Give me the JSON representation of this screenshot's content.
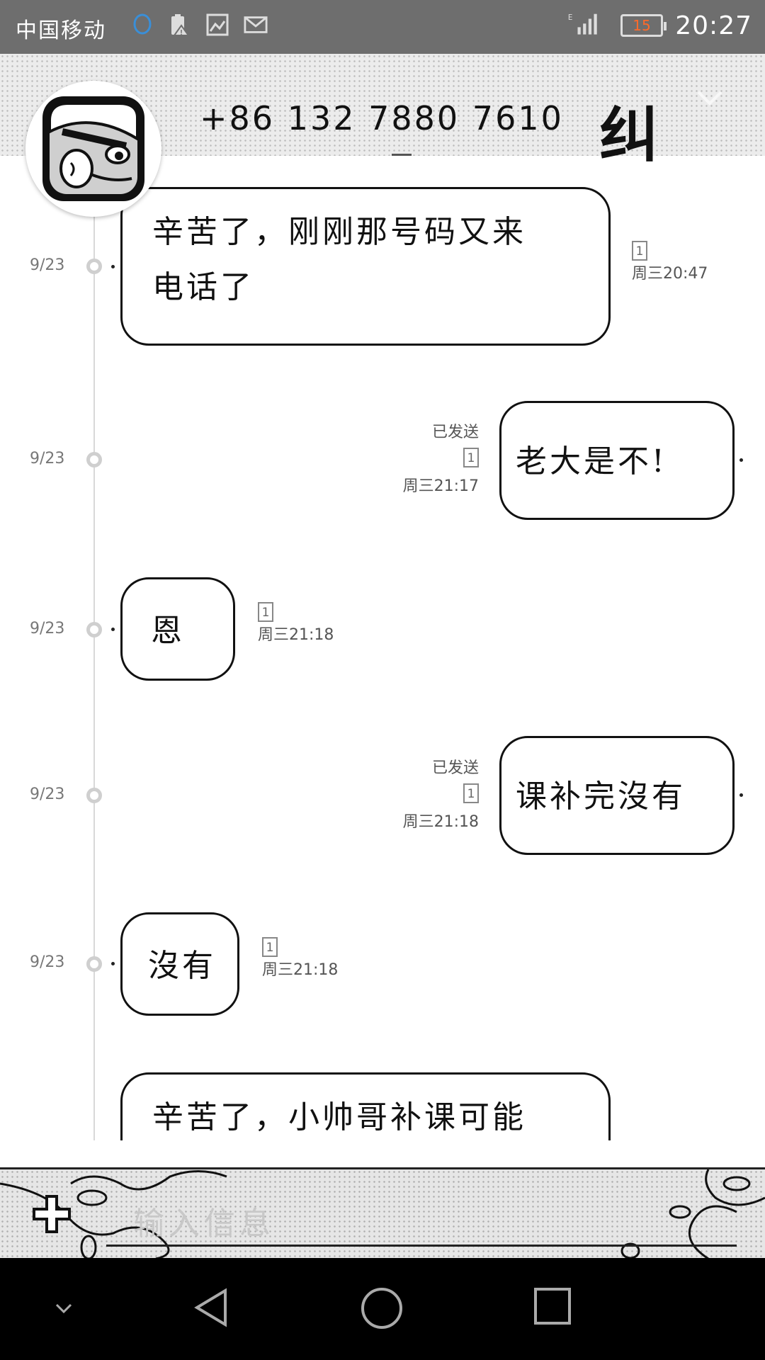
{
  "status_bar": {
    "carrier": "中国移动",
    "battery": "15",
    "time": "20:27",
    "icons": [
      "qq-icon",
      "battery-warning-icon",
      "gallery-icon",
      "mail-icon",
      "signal-icon"
    ]
  },
  "header": {
    "phone": "+86 132 7880 7610",
    "glyph": "纠"
  },
  "messages": [
    {
      "date": "9/23",
      "text_lines": [
        "辛苦了，刚刚那号码又来",
        "电话了"
      ],
      "sim": "1",
      "time": "周三20:47",
      "direction": "incoming"
    },
    {
      "date": "9/23",
      "text_lines": [
        "老大是不!"
      ],
      "status": "已发送",
      "sim": "1",
      "time": "周三21:17",
      "direction": "outgoing"
    },
    {
      "date": "9/23",
      "text_lines": [
        "恩"
      ],
      "sim": "1",
      "time": "周三21:18",
      "direction": "incoming"
    },
    {
      "date": "9/23",
      "text_lines": [
        "课补完沒有"
      ],
      "status": "已发送",
      "sim": "1",
      "time": "周三21:18",
      "direction": "outgoing"
    },
    {
      "date": "9/23",
      "text_lines": [
        "沒有"
      ],
      "sim": "1",
      "time": "周三21:18",
      "direction": "incoming"
    },
    {
      "text_lines": [
        "辛苦了，小帅哥补课可能"
      ],
      "direction": "incoming"
    }
  ],
  "composer": {
    "placeholder": "输入信息"
  },
  "colors": {
    "status_bar": "#6e6e6e",
    "battery_text": "#ff6a2a",
    "qq_icon": "#3a8fd8",
    "navbar": "#000000"
  }
}
